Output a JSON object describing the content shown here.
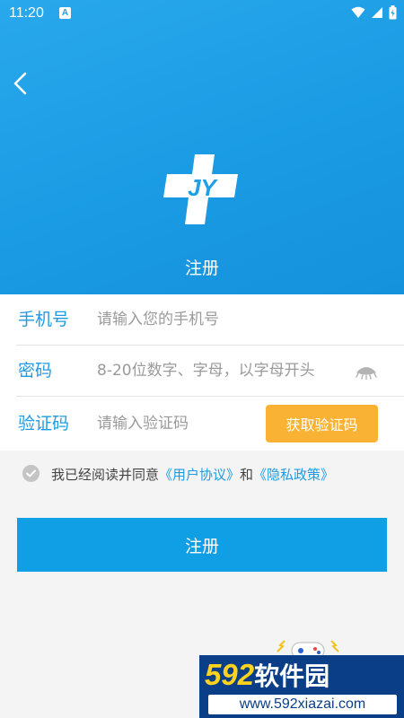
{
  "status_bar": {
    "time": "11:20",
    "badge": "A",
    "icons": [
      "wifi-icon",
      "cellular-icon",
      "battery-icon"
    ]
  },
  "header": {
    "title": "注册",
    "logo_text": "JY",
    "background_color": "#1e9fe6"
  },
  "form": {
    "phone_label": "手机号",
    "phone_placeholder": "请输入您的手机号",
    "password_label": "密码",
    "password_placeholder": "8-20位数字、字母，以字母开头",
    "code_label": "验证码",
    "code_placeholder": "请输入验证码",
    "get_code_button": "获取验证码",
    "accent_color": "#1e9be1",
    "button_color": "#f9b233"
  },
  "agreement": {
    "prefix": "我已经阅读并同意",
    "user_agreement": "《用户协议》",
    "conjunction": "和",
    "privacy_policy": "《隐私政策》"
  },
  "submit": {
    "label": "注册",
    "color": "#109ee5"
  },
  "watermark": {
    "brand_number": "592",
    "brand_name": "软件园",
    "url": "www.592xiazai.com"
  }
}
